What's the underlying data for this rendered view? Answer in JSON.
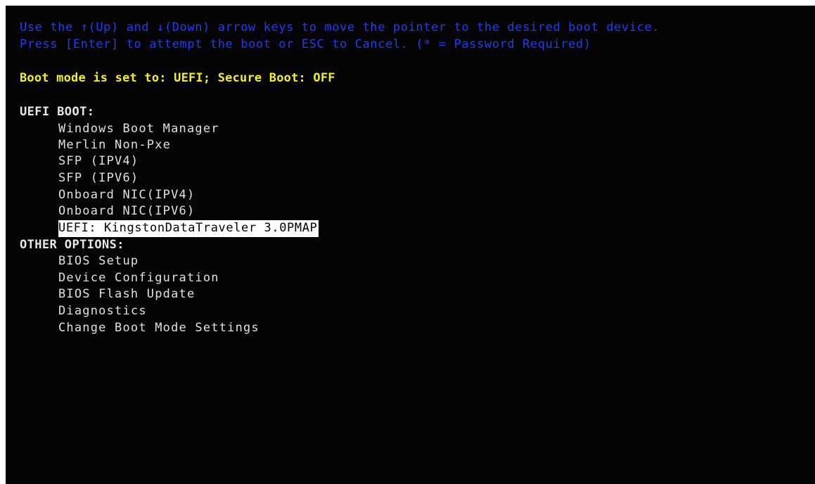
{
  "instructions": {
    "line1": "Use the ↑(Up) and ↓(Down) arrow keys to move the pointer to the desired boot device.",
    "line2": "Press [Enter] to attempt the boot or ESC to Cancel. (* = Password Required)"
  },
  "status": {
    "boot_mode_text": "Boot mode is set to: UEFI; Secure Boot: OFF"
  },
  "uefi_boot": {
    "heading": "UEFI BOOT:",
    "items": [
      {
        "label": "Windows Boot Manager"
      },
      {
        "label": "Merlin Non-Pxe"
      },
      {
        "label": "SFP (IPV4)"
      },
      {
        "label": "SFP (IPV6)"
      },
      {
        "label": "Onboard NIC(IPV4)"
      },
      {
        "label": "Onboard NIC(IPV6)"
      },
      {
        "label": "UEFI: KingstonDataTraveler 3.0PMAP"
      }
    ],
    "selected_label": "UEFI: KingstonDataTraveler 3.0PMAP"
  },
  "other_options": {
    "heading": "OTHER OPTIONS:",
    "items": [
      {
        "label": "BIOS Setup"
      },
      {
        "label": "Device Configuration"
      },
      {
        "label": "BIOS Flash Update"
      },
      {
        "label": "Diagnostics"
      },
      {
        "label": "Change Boot Mode Settings"
      }
    ]
  },
  "colors": {
    "background": "#050505",
    "instruction_text": "#1f3df5",
    "boot_mode_text": "#f2ef2a",
    "menu_text": "#e0e0e0",
    "selection_highlight": "#ffffff"
  }
}
